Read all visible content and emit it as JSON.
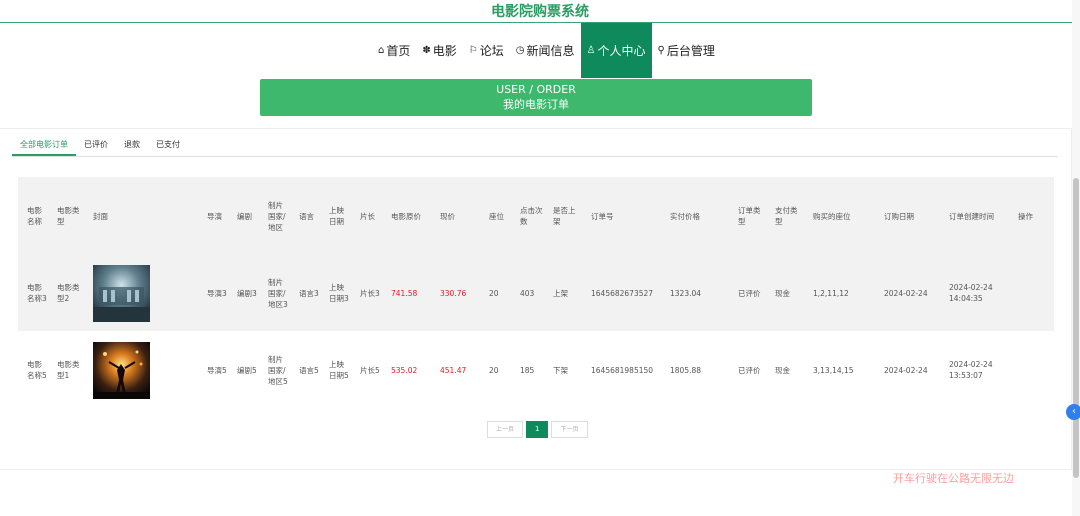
{
  "site": {
    "title": "电影院购票系统"
  },
  "nav": [
    {
      "icon": "⌂",
      "label": "首页"
    },
    {
      "icon": "✽",
      "label": "电影"
    },
    {
      "icon": "⚐",
      "label": "论坛"
    },
    {
      "icon": "◷",
      "label": "新闻信息"
    },
    {
      "icon": "♙",
      "label": "个人中心"
    },
    {
      "icon": "⚲",
      "label": "后台管理"
    }
  ],
  "banner": {
    "en": "USER / ORDER",
    "zh": "我的电影订单"
  },
  "tabs": [
    "全部电影订单",
    "已评价",
    "退款",
    "已支付"
  ],
  "table": {
    "headers": [
      "电影名称",
      "电影类型",
      "封面",
      "导演",
      "编剧",
      "制片国家/地区",
      "语言",
      "上映日期",
      "片长",
      "电影原价",
      "现价",
      "座位",
      "点击次数",
      "是否上架",
      "订单号",
      "实付价格",
      "订单类型",
      "支付类型",
      "购买的座位",
      "订购日期",
      "订单创建时间",
      "操作"
    ],
    "rows": [
      {
        "name": "电影名称3",
        "type": "电影类型2",
        "cover": "cover-hall",
        "director": "导演3",
        "writer": "编剧3",
        "country": "制片国家/地区3",
        "language": "语言3",
        "release": "上映日期3",
        "length": "片长3",
        "original_price": "741.58",
        "price": "330.76",
        "seats": "20",
        "clicks": "403",
        "shelf": "上架",
        "order_no": "1645682673527",
        "paid": "1323.04",
        "order_type": "已评价",
        "pay_type": "现金",
        "bought_seats": "1,2,11,12",
        "order_date": "2024-02-24",
        "created": "2024-02-24 14:04:35",
        "op": ""
      },
      {
        "name": "电影名称5",
        "type": "电影类型1",
        "cover": "cover-stage",
        "director": "导演5",
        "writer": "编剧5",
        "country": "制片国家/地区5",
        "language": "语言5",
        "release": "上映日期5",
        "length": "片长5",
        "original_price": "535.02",
        "price": "451.47",
        "seats": "20",
        "clicks": "185",
        "shelf": "下架",
        "order_no": "1645681985150",
        "paid": "1805.88",
        "order_type": "已评价",
        "pay_type": "现金",
        "bought_seats": "3,13,14,15",
        "order_date": "2024-02-24",
        "created": "2024-02-24 13:53:07",
        "op": ""
      }
    ]
  },
  "pager": {
    "prev": "上一页",
    "current": "1",
    "next": "下一页"
  },
  "watermark": "开车行驶在公路无限无边",
  "side_button_icon": "chevron-left-icon",
  "colors": {
    "brand": "#0f8a5c",
    "banner": "#3db86d",
    "price": "#e02020",
    "title": "#2a9d64"
  }
}
